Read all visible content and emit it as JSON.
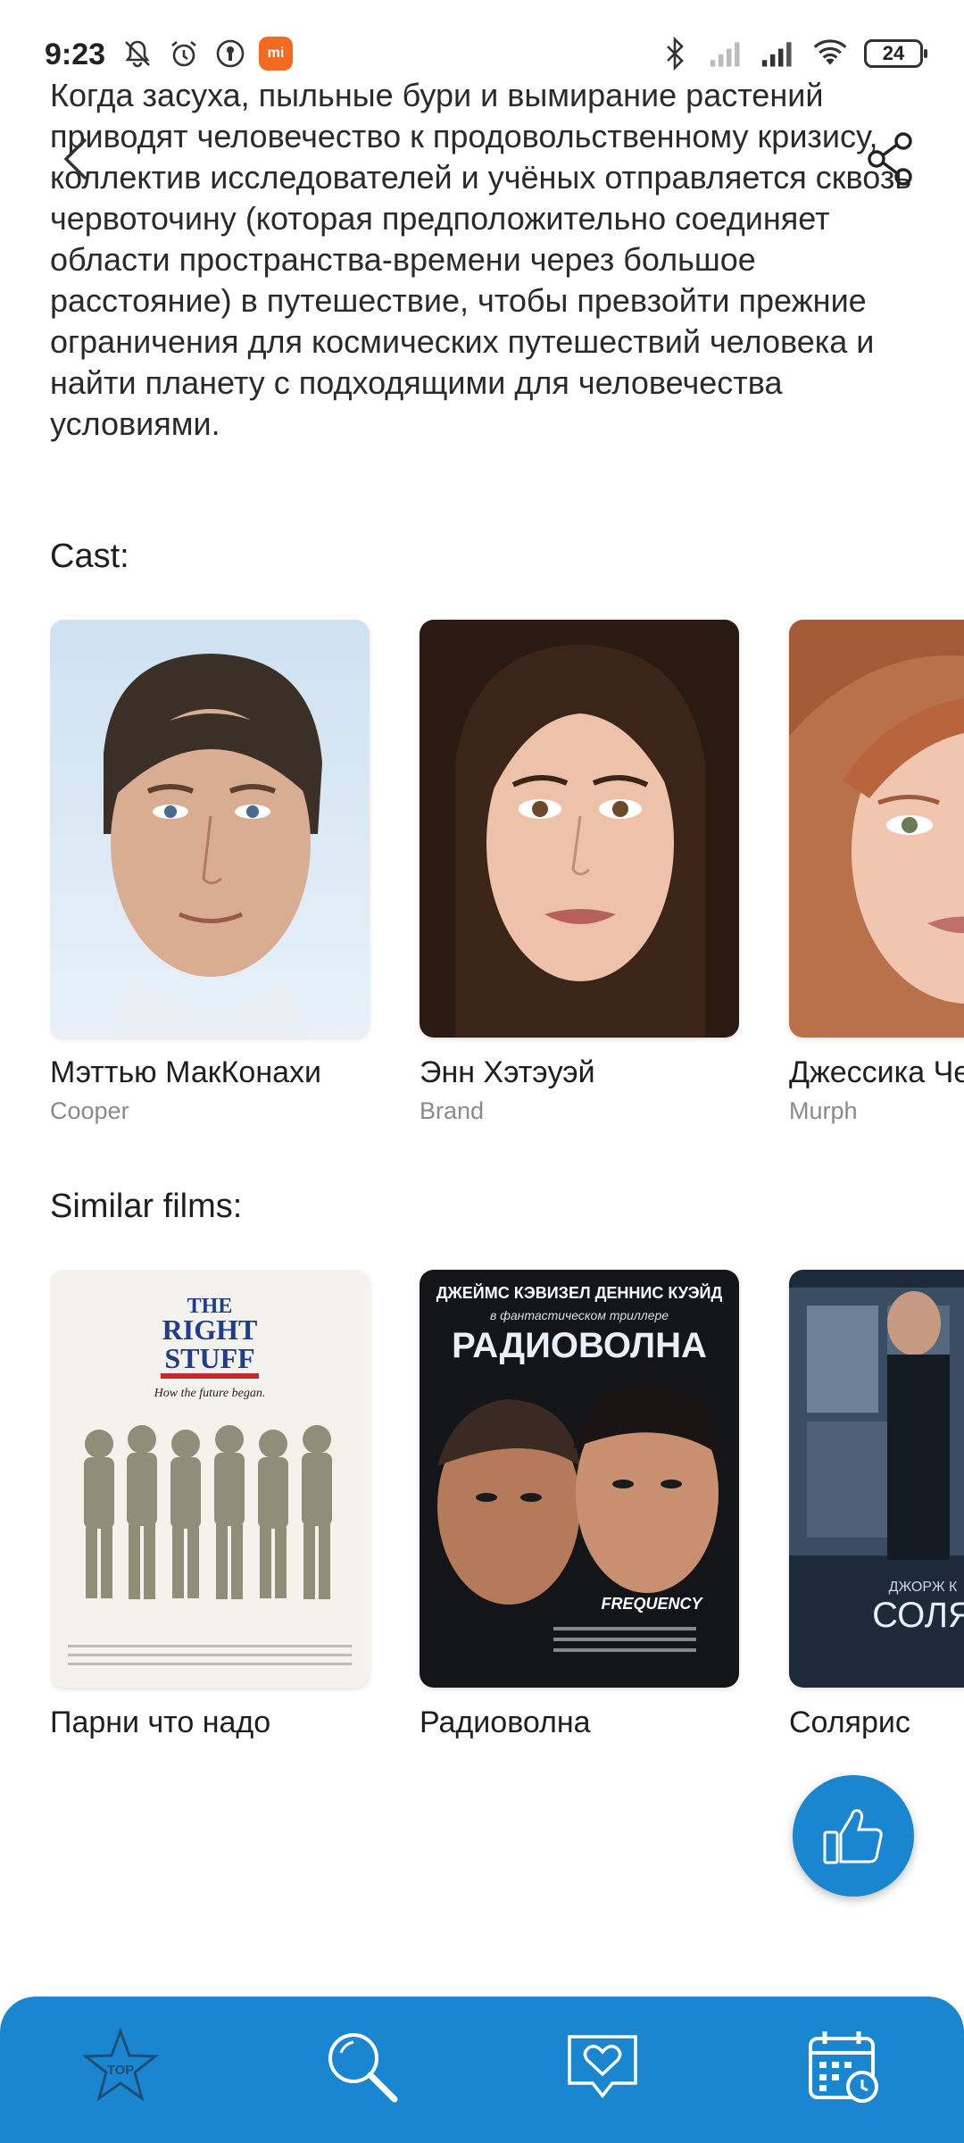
{
  "status_bar": {
    "time": "9:23",
    "battery": "24"
  },
  "description": "Когда засуха, пыльные бури и вымирание растений приводят человечество к продовольственному кризису, коллектив исследователей и учёных отправляется сквозь червоточину (которая предположительно соединяет области пространства-времени через большое расстояние) в путешествие, чтобы превзойти прежние ограничения для космических путешествий человека и найти планету с подходящими для человечества условиями.",
  "cast": {
    "title": "Cast:",
    "items": [
      {
        "name": "Мэттью МакКонахи",
        "role": "Cooper"
      },
      {
        "name": "Энн Хэтэуэй",
        "role": "Brand"
      },
      {
        "name": "Джессика Честейн",
        "role": "Murph"
      }
    ]
  },
  "similar": {
    "title": "Similar films:",
    "items": [
      {
        "title": "Парни что надо",
        "poster": {
          "line1": "THE",
          "line2": "RIGHT",
          "line3": "STUFF",
          "tagline": "How the future began."
        }
      },
      {
        "title": "Радиоволна",
        "poster": {
          "actors": "ДЖЕЙМС КЭВИЗЕЛ  ДЕННИС КУЭЙД",
          "subtitle": "в фантастическом триллере",
          "heading": "РАДИОВОЛНА",
          "brand": "FREQUENCY"
        }
      },
      {
        "title": "Солярис",
        "poster": {
          "actor": "ДЖОРЖ К",
          "heading": "СОЛЯ"
        }
      }
    ]
  },
  "colors": {
    "accent": "#1a86cf",
    "text": "#1e1e1e",
    "secondary_text": "#8a8a8a"
  },
  "icons": {
    "back": "chevron-left-icon",
    "share": "share-icon",
    "like": "thumbs-up-icon",
    "nav": [
      "top-star-icon",
      "search-icon",
      "heart-chat-icon",
      "calendar-clock-icon"
    ]
  },
  "nav_top_label": "TOP"
}
